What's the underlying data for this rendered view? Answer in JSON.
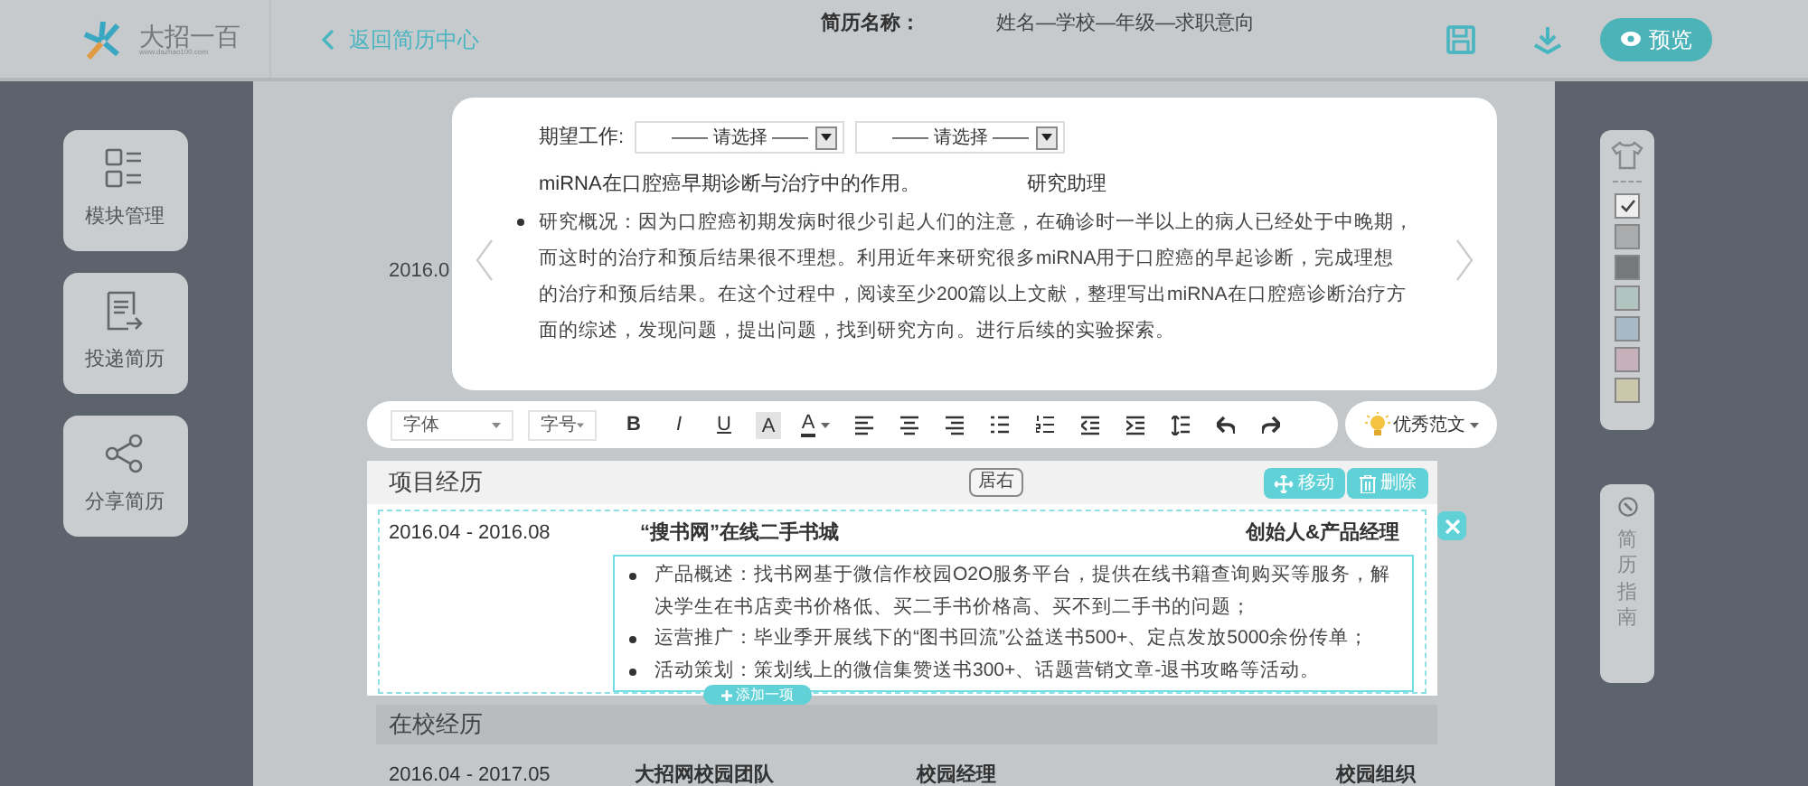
{
  "header": {
    "logo_text": "大招一百",
    "logo_url": "www.dazhao100.com",
    "back_link": "返回简历中心",
    "resume_name_label": "简历名称：",
    "resume_name": "姓名—学校—年级—求职意向",
    "preview_button": "预览"
  },
  "left_sidebar": [
    {
      "kind": "modules",
      "label": "模块管理"
    },
    {
      "kind": "deliver",
      "label": "投递简历"
    },
    {
      "kind": "share",
      "label": "分享简历"
    }
  ],
  "background_date": "2016.0",
  "popup": {
    "expected_job_label": "期望工作:",
    "selects": [
      "—— 请选择 ——",
      "—— 请选择 ——"
    ],
    "title": "miRNA在口腔癌早期诊断与治疗中的作用。",
    "role": "研究助理",
    "bullets": [
      "研究概况：因为口腔癌初期发病时很少引起人们的注意，在确诊时一半以上的病人已经处于中晚期，而这时的治疗和预后结果很不理想。利用近年来研究很多miRNA用于口腔癌的早起诊断，完成理想的治疗和预后结果。在这个过程中，阅读至少200篇以上文献，整理写出miRNA在口腔癌诊断治疗方面的综述，发现问题，提出问题，找到研究方向。进行后续的实验探索。"
    ]
  },
  "toolbar": {
    "font_select": "字体",
    "size_select": "字号",
    "buttons": [
      {
        "kind": "bold",
        "label": "B"
      },
      {
        "kind": "italic",
        "label": "I"
      },
      {
        "kind": "underline",
        "label": "U"
      },
      {
        "kind": "highlight",
        "label": "A"
      },
      {
        "kind": "font-color",
        "label": "A"
      },
      {
        "kind": "align-left"
      },
      {
        "kind": "align-center"
      },
      {
        "kind": "align-right"
      },
      {
        "kind": "bullet-list"
      },
      {
        "kind": "numbered-list"
      },
      {
        "kind": "outdent"
      },
      {
        "kind": "indent"
      },
      {
        "kind": "line-spacing"
      },
      {
        "kind": "undo"
      },
      {
        "kind": "redo"
      }
    ],
    "example_button": "优秀范文"
  },
  "project_section": {
    "title": "项目经历",
    "align_tooltip": "居右",
    "move_button": "移动",
    "delete_button": "删除",
    "date": "2016.04 - 2016.08",
    "name": "“搜书网”在线二手书城",
    "role": "创始人&产品经理",
    "bullets": [
      "产品概述：找书网基于微信作校园O2O服务平台，提供在线书籍查询购买等服务，解决学生在书店卖书价格低、买二手书价格高、买不到二手书的问题；",
      "运营推广：毕业季开展线下的“图书回流”公益送书500+、定点发放5000余份传单；",
      "活动策划：策划线上的微信集赞送书300+、话题营销文章-退书攻略等活动。"
    ],
    "add_button": "添加一项"
  },
  "campus_section": {
    "title": "在校经历",
    "date": "2016.04 - 2017.05",
    "org": "大招网校园团队",
    "position": "校园经理",
    "category": "校园组织"
  },
  "right_sidebar": {
    "swatches": [
      {
        "color": "#eeeeee",
        "selected": true
      },
      {
        "color": "#a9abad",
        "selected": false
      },
      {
        "color": "#76797c",
        "selected": false
      },
      {
        "color": "#b2c4bf",
        "selected": false
      },
      {
        "color": "#a7b9c5",
        "selected": false
      },
      {
        "color": "#c6b1bb",
        "selected": false
      },
      {
        "color": "#c9c8ad",
        "selected": false
      }
    ],
    "guide_label": "简历指南"
  }
}
